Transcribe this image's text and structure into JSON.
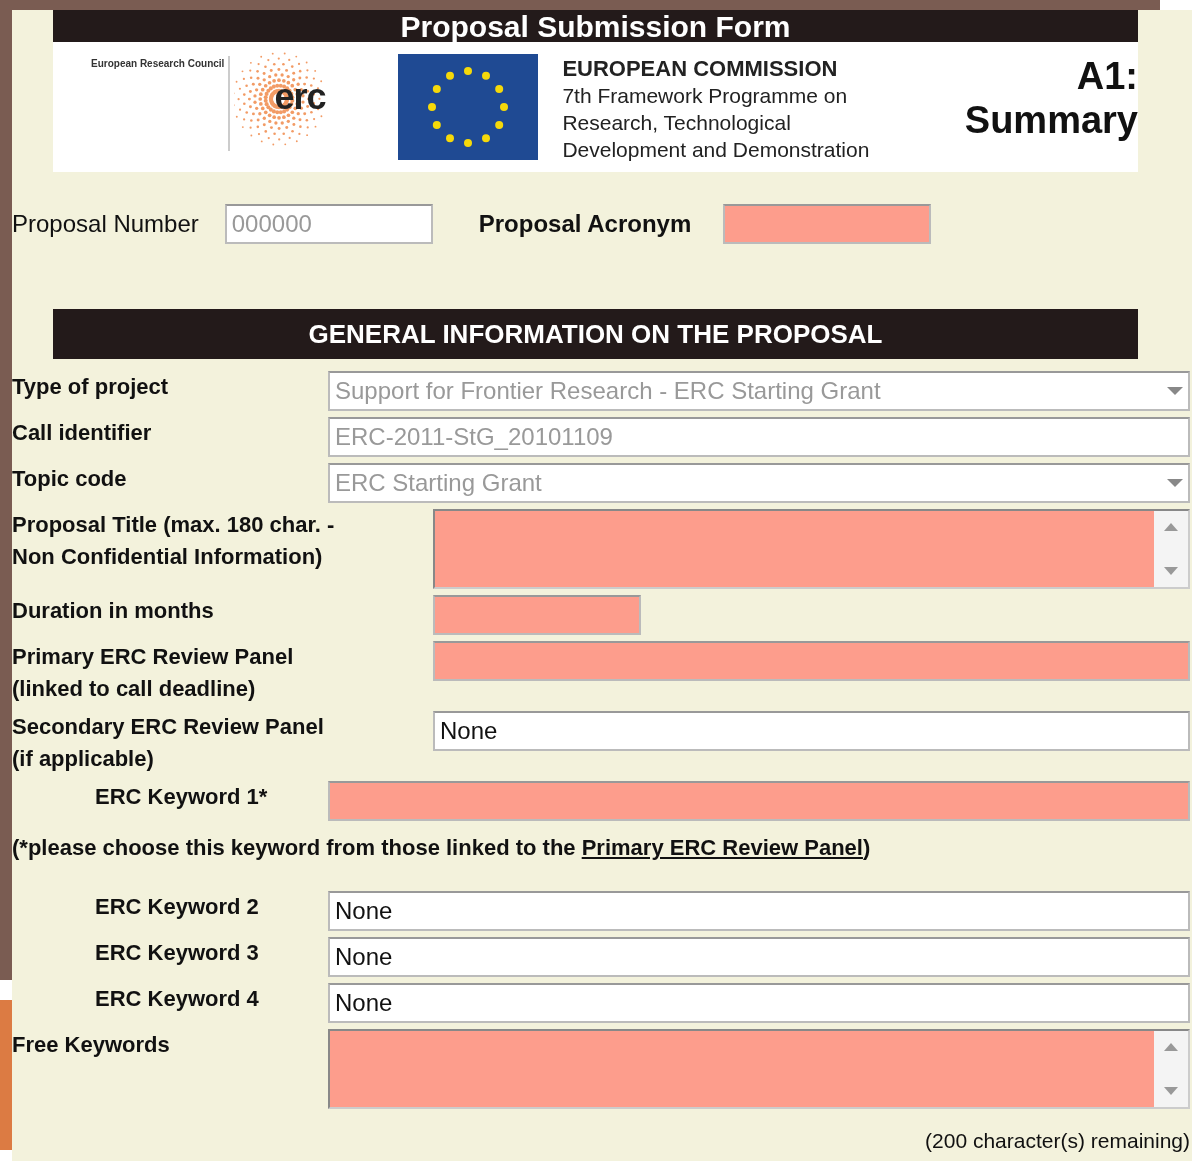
{
  "header": {
    "title": "Proposal Submission Form",
    "erc_caption": "European Research Council",
    "erc_logo_text": "erc",
    "commission": {
      "name": "EUROPEAN COMMISSION",
      "lines": [
        "7th Framework Programme on",
        "Research, Technological",
        "Development and Demonstration"
      ]
    },
    "section_code": "A1:",
    "section_name": "Summary"
  },
  "top_fields": [
    {
      "label": "Proposal Number",
      "bold": false,
      "value": "000000",
      "disabled": true,
      "required": false
    },
    {
      "label": "Proposal Acronym",
      "bold": true,
      "disabled": false,
      "required": true
    }
  ],
  "section_title": "GENERAL INFORMATION ON THE PROPOSAL",
  "rows": [
    {
      "label": "Type of project",
      "kind": "dropdown",
      "value": "Support for Frontier Research - ERC Starting Grant",
      "disabled": true,
      "required": false
    },
    {
      "label": "Call identifier",
      "kind": "text",
      "value": "ERC-2011-StG_20101109",
      "disabled": true,
      "required": false
    },
    {
      "label": "Topic code",
      "kind": "dropdown",
      "value": "ERC Starting Grant",
      "disabled": true,
      "required": false
    },
    {
      "label": "Proposal Title  (max. 180 char. - Non Confidential Information)",
      "kind": "textarea",
      "disabled": false,
      "required": true
    },
    {
      "label": "Duration in months",
      "kind": "text",
      "disabled": false,
      "required": true
    },
    {
      "label": "Primary ERC Review Panel (linked to call deadline)",
      "kind": "text",
      "disabled": false,
      "required": true
    },
    {
      "label": "Secondary ERC Review Panel (if applicable)",
      "kind": "text",
      "value": "None",
      "disabled": false,
      "required": false
    },
    {
      "label": "ERC Keyword 1*",
      "kind": "text",
      "disabled": false,
      "required": true
    },
    {
      "kind": "note",
      "before": "(*please choose this keyword from those linked to the ",
      "link": "Primary ERC Review Panel",
      "after": ")"
    },
    {
      "label": "ERC Keyword 2",
      "kind": "text",
      "value": "None",
      "disabled": false,
      "required": false
    },
    {
      "label": "ERC Keyword 3",
      "kind": "text",
      "value": "None",
      "disabled": false,
      "required": false
    },
    {
      "label": "ERC Keyword 4",
      "kind": "text",
      "value": "None",
      "disabled": false,
      "required": false
    },
    {
      "label": "Free Keywords",
      "kind": "textarea",
      "disabled": false,
      "required": true
    }
  ],
  "remaining": "(200 character(s) remaining)"
}
